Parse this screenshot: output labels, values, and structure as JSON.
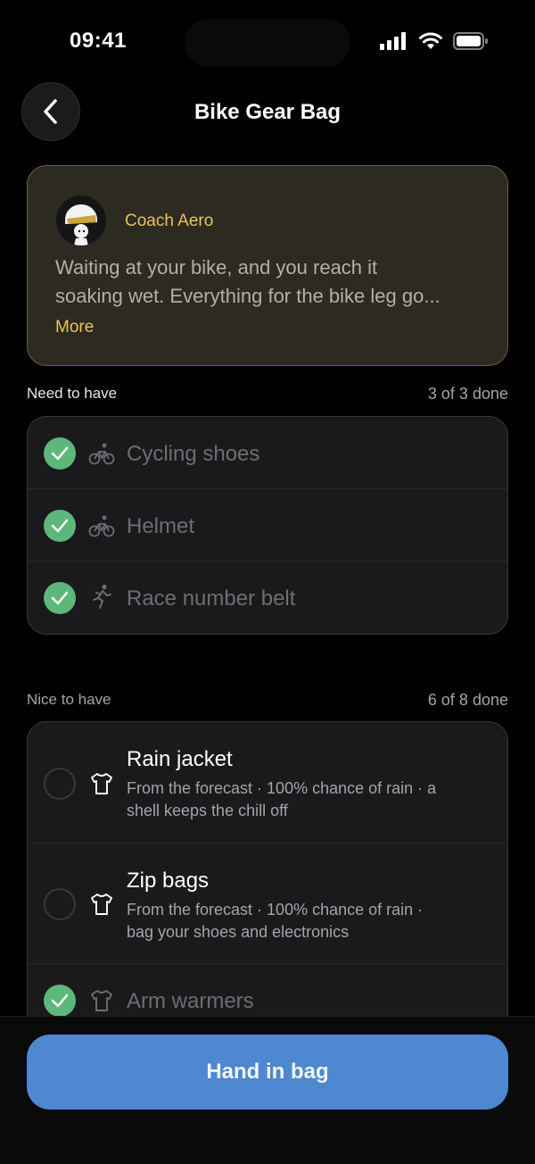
{
  "status_bar": {
    "time": "09:41"
  },
  "nav": {
    "title": "Bike Gear Bag"
  },
  "coach": {
    "name": "Coach Aero",
    "message_line1": "Waiting at your bike, and you reach it",
    "message_line2": "soaking wet. Everything for the bike leg go...",
    "more_label": "More"
  },
  "need_section": {
    "label": "Need to have",
    "count": "3 of 3 done",
    "items": [
      {
        "title": "Cycling shoes",
        "icon": "bike-icon",
        "checked": true
      },
      {
        "title": "Helmet",
        "icon": "bike-icon",
        "checked": true
      },
      {
        "title": "Race number belt",
        "icon": "run-icon",
        "checked": true
      }
    ]
  },
  "nice_section": {
    "label": "Nice to have",
    "count": "6 of 8 done",
    "items": [
      {
        "title": "Rain jacket",
        "icon": "shirt-icon",
        "checked": false,
        "subtitle_line1": "From the forecast · 100% chance of rain · a",
        "subtitle_line2": "shell keeps the chill off"
      },
      {
        "title": "Zip bags",
        "icon": "shirt-icon",
        "checked": false,
        "subtitle_line1": "From the forecast · 100% chance of rain ·",
        "subtitle_line2": "bag your shoes and electronics"
      },
      {
        "title": "Arm warmers",
        "icon": "shirt-icon",
        "checked": true
      }
    ]
  },
  "cta": {
    "label": "Hand in bag"
  },
  "colors": {
    "accent": "#4d88d1",
    "coach_gold": "#e9c45c",
    "check_green": "#5cb87a",
    "card_bg": "#1a1a1d"
  }
}
